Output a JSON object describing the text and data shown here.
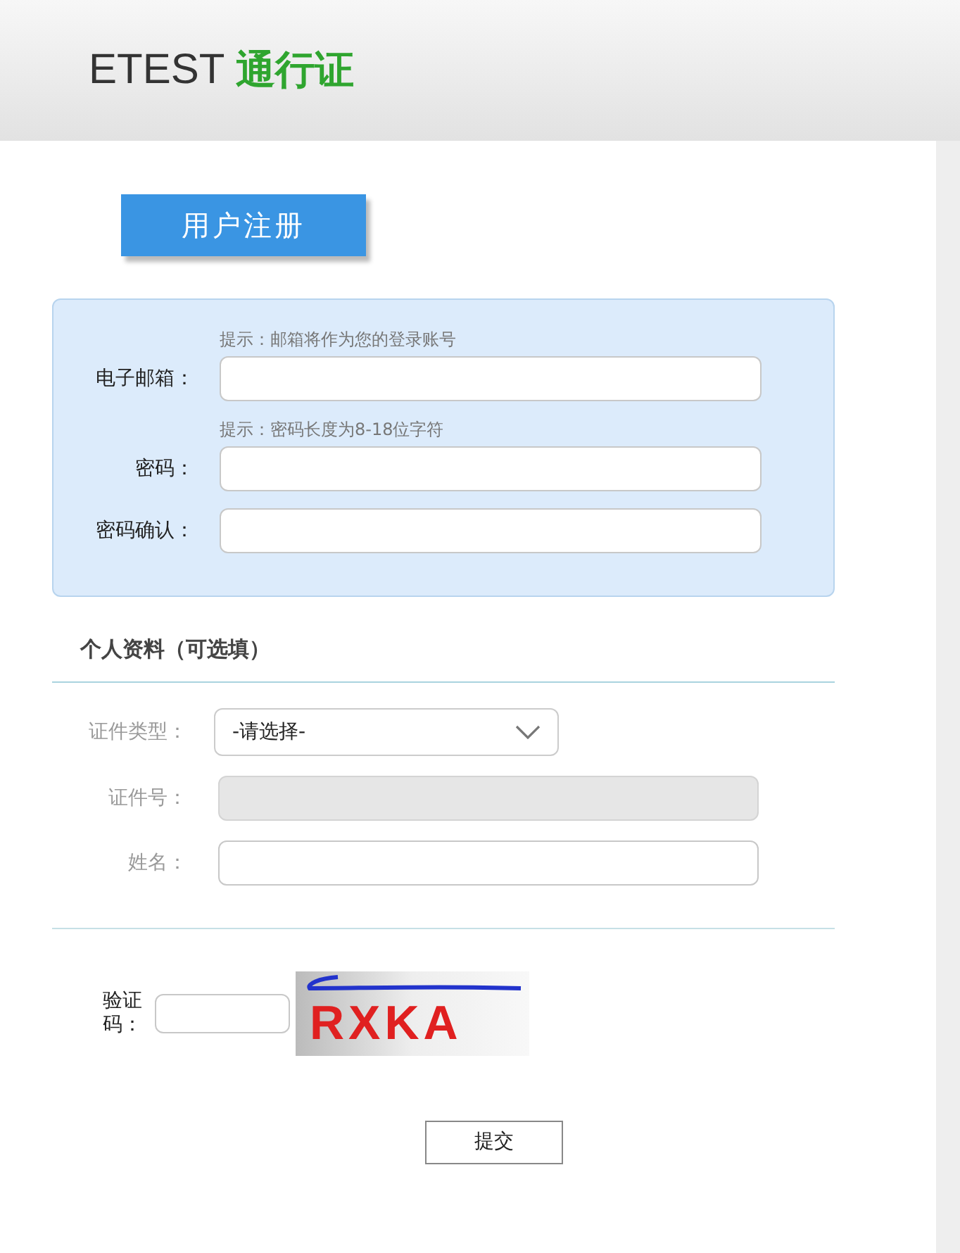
{
  "header": {
    "brand": "ETEST",
    "product": "通行证"
  },
  "tab": {
    "label": "用户注册",
    "selected": true
  },
  "account_fields": [
    {
      "label": "电子邮箱：",
      "hint": "提示：邮箱将作为您的登录账号"
    },
    {
      "label": "密码：",
      "hint": "提示：密码长度为8-18位字符"
    },
    {
      "label": "密码确认："
    }
  ],
  "profile": {
    "title": "个人资料（可选填）",
    "fields": [
      {
        "kind": "select",
        "label": "证件类型：",
        "value": "-请选择-",
        "disabled": false
      },
      {
        "kind": "text",
        "label": "证件号：",
        "disabled": true
      },
      {
        "kind": "text",
        "label": "姓名：",
        "disabled": false
      }
    ]
  },
  "captcha": {
    "label": "验证码：",
    "image_text": "RXKA"
  },
  "submit": "提交"
}
